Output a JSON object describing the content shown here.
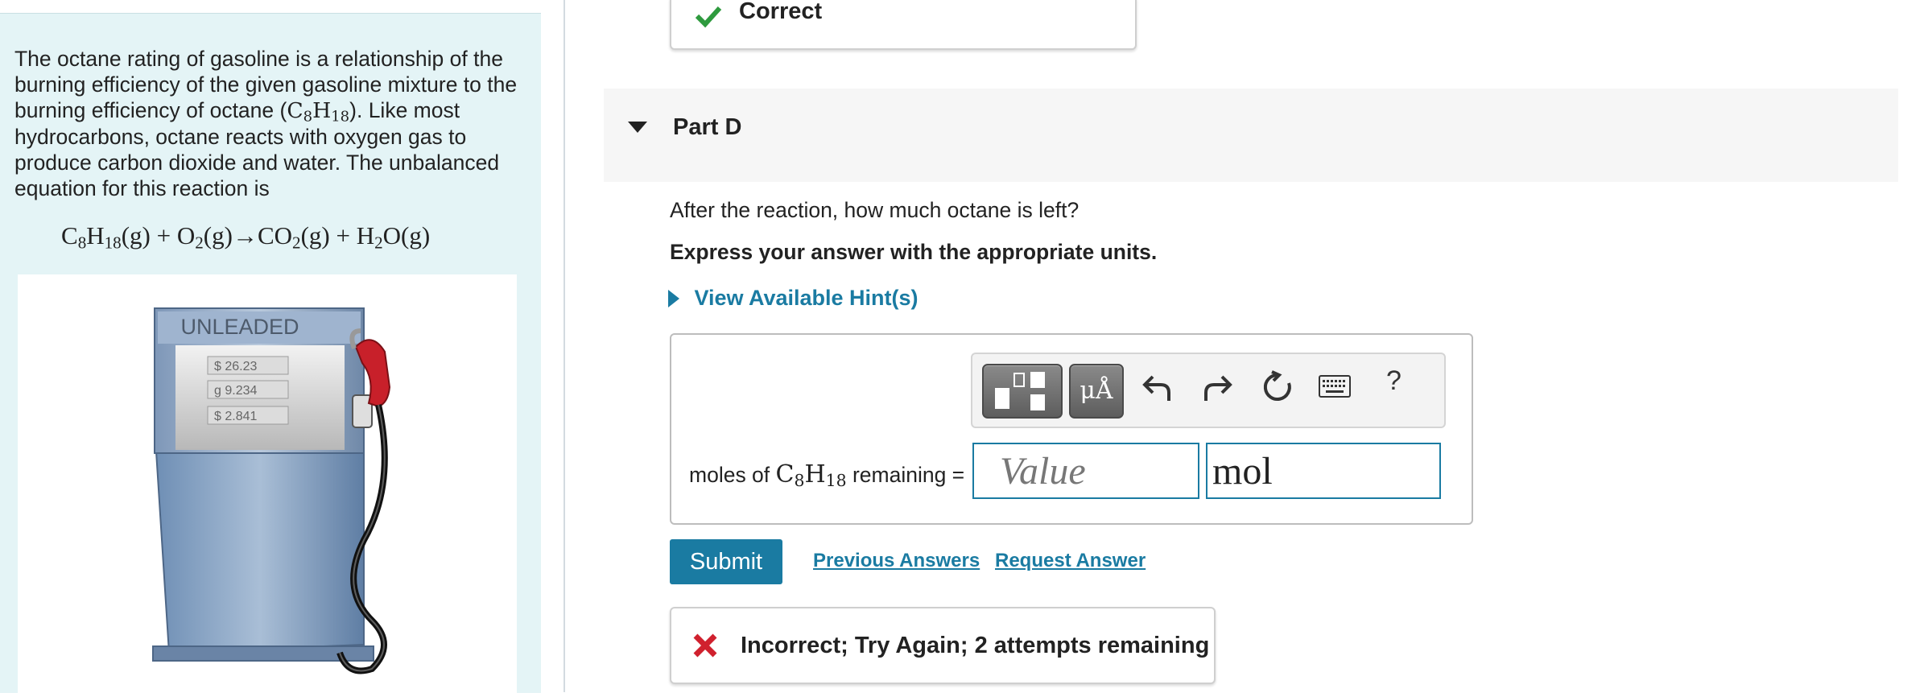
{
  "left_panel": {
    "intro_pre": "The octane rating of gasoline is a relationship of the burning efficiency of the given gasoline mixture to the burning efficiency of octane (",
    "intro_post": "). Like most hydrocarbons, octane reacts with oxygen gas to produce carbon dioxide and water. The unbalanced equation for this reaction is",
    "octane_formula": {
      "c": "C",
      "c_sub": "8",
      "h": "H",
      "h_sub": "18"
    },
    "equation": {
      "reactant1": "C",
      "r1_c_sub": "8",
      "r1_h": "H",
      "r1_h_sub": "18",
      "r1_state": "(g)",
      "plus1": " + ",
      "reactant2": "O",
      "r2_sub": "2",
      "r2_state": "(g)",
      "arrow": "→",
      "product1": "CO",
      "p1_sub": "2",
      "p1_state": "(g)",
      "plus2": " + ",
      "product2_h": "H",
      "p2_sub": "2",
      "product2_o": "O",
      "p2_state": "(g)"
    },
    "pump": {
      "sign": "UNLEADED",
      "readout_price": "$ 26.23",
      "readout_gallons": "g 9.234",
      "readout_unit_price": "$ 2.841"
    }
  },
  "correct_feedback": {
    "text": "Correct",
    "color": "#2e9a3e"
  },
  "part": {
    "title": "Part D"
  },
  "question": "After the reaction, how much octane is left?",
  "instruction": "Express your answer with the appropriate units.",
  "hint_label": "View Available Hint(s)",
  "toolbar": {
    "templates_icon": "templates-icon",
    "units_label": "μÅ",
    "undo_icon": "undo-icon",
    "redo_icon": "redo-icon",
    "reset_icon": "reset-icon",
    "keyboard_icon": "keyboard-icon",
    "help_label": "?"
  },
  "answer": {
    "label_pre": "moles of ",
    "label_formula": {
      "c": "C",
      "c_sub": "8",
      "h": "H",
      "h_sub": "18"
    },
    "label_post": " remaining =",
    "value_placeholder": "Value",
    "unit_value": "mol"
  },
  "actions": {
    "submit_label": "Submit",
    "previous_answers": "Previous Answers",
    "request_answer": "Request Answer"
  },
  "incorrect_feedback": {
    "text": "Incorrect; Try Again; 2 attempts remaining",
    "color": "#d0212e"
  },
  "colors": {
    "accent": "#1a7ba2",
    "left_panel_bg": "#e4f4f6",
    "part_bar_bg": "#f6f6f6"
  }
}
